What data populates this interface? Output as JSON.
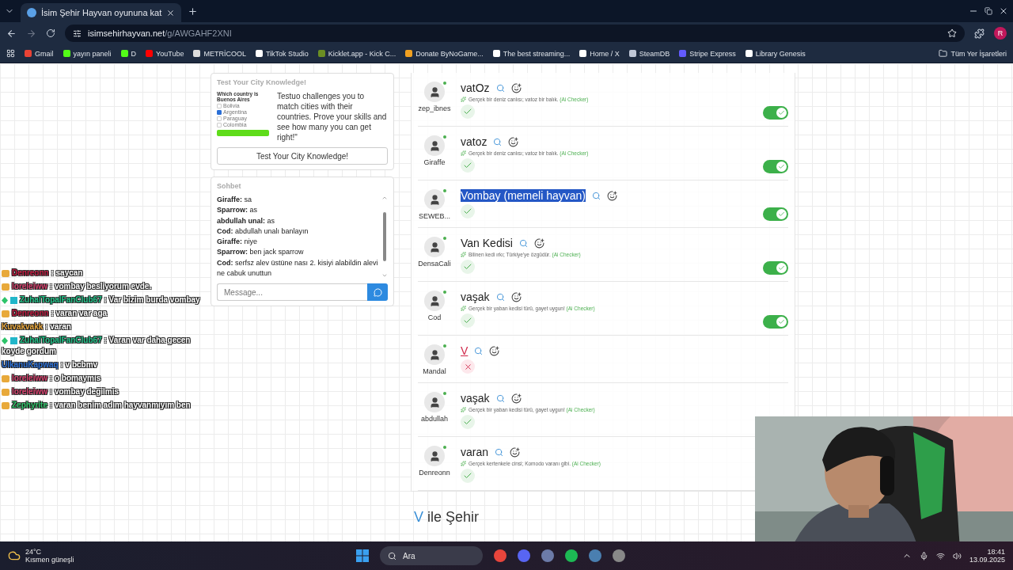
{
  "browser": {
    "tab_title": "İsim Şehir Hayvan oyununa kat",
    "url_host": "isimsehirhayvan.net",
    "url_path": "/g/AWGAHF2XNI",
    "profile": "R",
    "folder": "Tüm Yer İşaretleri",
    "bookmarks": [
      {
        "label": "Gmail",
        "color": "#ea4335"
      },
      {
        "label": "yayın paneli",
        "color": "#53fc18"
      },
      {
        "label": "D",
        "color": "#53fc18"
      },
      {
        "label": "YouTube",
        "color": "#ff0000"
      },
      {
        "label": "METRİCOOL",
        "color": "#dddddd"
      },
      {
        "label": "TikTok Studio",
        "color": "#ffffff"
      },
      {
        "label": "Kicklet.app - Kick C...",
        "color": "#6b8e23"
      },
      {
        "label": "Donate ByNoGame...",
        "color": "#f0a020"
      },
      {
        "label": "The best streaming...",
        "color": "#ffffff"
      },
      {
        "label": "Home / X",
        "color": "#ffffff"
      },
      {
        "label": "SteamDB",
        "color": "#c0c8d8"
      },
      {
        "label": "Stripe Express",
        "color": "#635bff"
      },
      {
        "label": "Library Genesis",
        "color": "#ffffff"
      }
    ]
  },
  "promo": {
    "title": "Test Your City Knowledge!",
    "quiz_question": "Which country is Buenos Aires",
    "quiz_options": [
      {
        "label": "Bolivia",
        "checked": false
      },
      {
        "label": "Argentina",
        "checked": true
      },
      {
        "label": "Paraguay",
        "checked": false
      },
      {
        "label": "Colombia",
        "checked": false
      }
    ],
    "description": "Testuo challenges you to match cities with their countries. Prove your skills and see how many you can get right!\"",
    "button": "Test Your City Knowledge!"
  },
  "chat": {
    "title": "Sohbet",
    "placeholder": "Message...",
    "messages": [
      {
        "user": "Giraffe:",
        "text": "sa"
      },
      {
        "user": "Sparrow:",
        "text": "as"
      },
      {
        "user": "abdullah unal:",
        "text": "as"
      },
      {
        "user": "Cod:",
        "text": "abdullah unalı banlayın"
      },
      {
        "user": "Giraffe:",
        "text": "niye"
      },
      {
        "user": "Sparrow:",
        "text": "ben jack sparrow"
      },
      {
        "user": "Cod:",
        "text": "serfsz alev üstüne nası 2. kisiyi alabildin alevi ne cabuk unuttun"
      }
    ]
  },
  "answers": [
    {
      "answer": "vatOz",
      "player": "zep_ibnes",
      "valid": true,
      "highlighted": false,
      "note": "Gerçek bir deniz canlısı; vatoz bir balık.",
      "checker": "(Ai Checker)",
      "toggle_on": true
    },
    {
      "answer": "vatoz",
      "player": "Giraffe",
      "valid": true,
      "highlighted": false,
      "note": "Gerçek bir deniz canlısı; vatoz bir balık.",
      "checker": "(Ai Checker)",
      "toggle_on": true
    },
    {
      "answer": "Vombay (memeli hayvan)",
      "player": "SEWEB...",
      "valid": true,
      "highlighted": true,
      "toggle_on": true
    },
    {
      "answer": "Van Kedisi",
      "player": "DensaCali",
      "valid": true,
      "highlighted": false,
      "note": "Bilinen kedi ırkı; Türkiye'ye özgüdür.",
      "checker": "(Ai Checker)",
      "toggle_on": true
    },
    {
      "answer": "vaşak",
      "player": "Cod",
      "valid": true,
      "highlighted": false,
      "note": "Gerçek bir yaban kedisi türü, gayet uygun!",
      "checker": "(Ai Checker)",
      "toggle_on": true
    },
    {
      "answer": "V",
      "player": "Mandal",
      "valid": false,
      "highlighted": false
    },
    {
      "answer": "vaşak",
      "player": "abdullah",
      "valid": true,
      "highlighted": false,
      "note": "Gerçek bir yaban kedisi türü, gayet uygun!",
      "checker": "(Ai Checker)"
    },
    {
      "answer": "varan",
      "player": "Denreonn",
      "valid": true,
      "highlighted": false,
      "note": "Gerçek kertenkele cinsi; Komodo varanı gibi.",
      "checker": "(Ai Checker)"
    }
  ],
  "section_heading": {
    "letter": "V",
    "text": "ile Şehir"
  },
  "stream_chat": [
    {
      "kind": "crown",
      "user": "Denreonn",
      "color": "#c0183f",
      "text": ": saycan"
    },
    {
      "kind": "crown",
      "user": "loreleiww",
      "color": "#d8406e",
      "text": ": vombay besliyorum evde."
    },
    {
      "kind": "gem",
      "user": "ZuhalTopalFanClub67",
      "color": "#22c48a",
      "text": ": Var bizim burda vombay"
    },
    {
      "kind": "crown",
      "user": "Denreonn",
      "color": "#c0183f",
      "text": ": varan var aga"
    },
    {
      "kind": "plain",
      "user": "Kuvakvakk",
      "color": "#e6a43a",
      "text": ": varan"
    },
    {
      "kind": "gem",
      "user": "ZuhalTopalFanClub67",
      "color": "#22c48a",
      "text": ": Varan var daha gecen koyde gordum"
    },
    {
      "kind": "plain",
      "user": "UlkanuKapwaq",
      "color": "#2a6fd6",
      "text": ": v bcbmv"
    },
    {
      "kind": "crown",
      "user": "loreleiww",
      "color": "#d8406e",
      "text": ": o bomaymıs"
    },
    {
      "kind": "crown",
      "user": "loreleiww",
      "color": "#d8406e",
      "text": ": vombay değilmis"
    },
    {
      "kind": "crown",
      "user": "Zephyrite",
      "color": "#2fc46a",
      "text": ": varan benim adım hayvanmıyım ben"
    }
  ],
  "taskbar": {
    "temperature": "24°C",
    "weather": "Kısmen güneşli",
    "search": "Ara",
    "time": "18:41",
    "date": "13.09.2025"
  }
}
